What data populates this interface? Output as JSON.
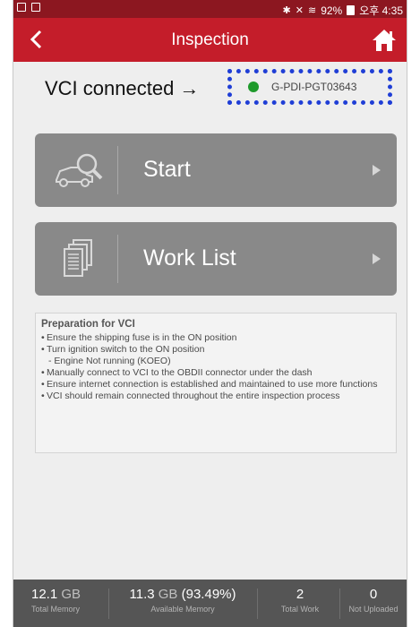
{
  "status_bar": {
    "bluetooth": "✱",
    "mute": "✕",
    "wifi": "≋",
    "battery": "92%",
    "time": "오후 4:35"
  },
  "app_bar": {
    "title": "Inspection",
    "back_icon": "chevron-left-icon",
    "home_icon": "home-icon",
    "color": "#c41d2a"
  },
  "vci": {
    "annotation": "VCI connected →",
    "device_name": "G-PDI-PGT03643",
    "status_color": "#1f9a2c",
    "highlight_color": "#1f3ed6"
  },
  "menu": {
    "start_label": "Start",
    "worklist_label": "Work List"
  },
  "preparation": {
    "title": "Preparation for VCI",
    "items": [
      "Ensure the shipping fuse is in the ON position",
      "Turn ignition switch to the ON position",
      "- Engine Not running (KOEO)",
      "Manually connect to VCI to the OBDII connector under the dash",
      "Ensure internet connection is established and maintained to use more functions",
      "VCI should remain connected throughout the entire inspection process"
    ]
  },
  "footer": {
    "total_memory_value": "12.1",
    "total_memory_unit": "GB",
    "total_memory_caption": "Total Memory",
    "available_memory_value": "11.3",
    "available_memory_unit": "GB",
    "available_memory_pct": "(93.49%)",
    "available_memory_caption": "Available Memory",
    "total_work_value": "2",
    "total_work_caption": "Total Work",
    "not_uploaded_value": "0",
    "not_uploaded_caption": "Not Uploaded"
  }
}
